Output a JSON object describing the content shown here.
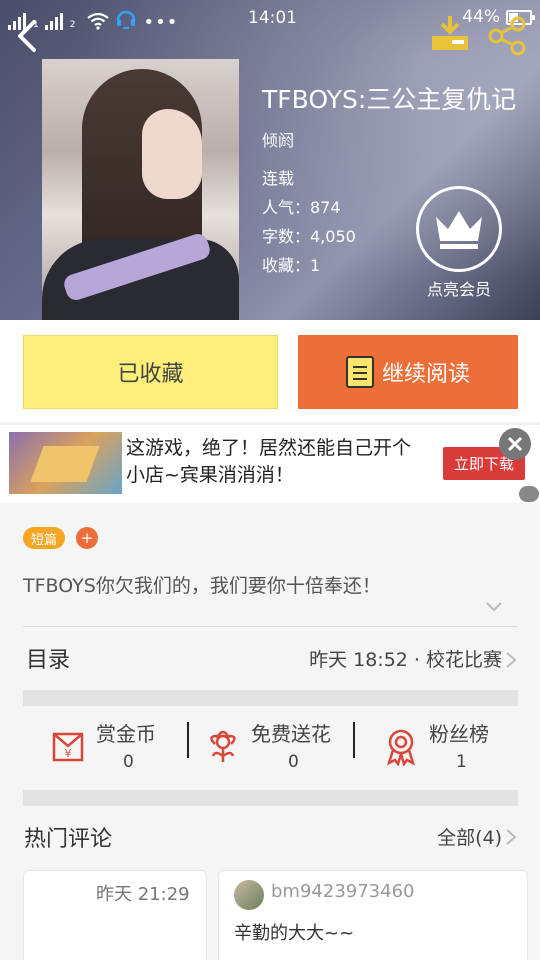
{
  "status_bar": {
    "sim1": "1",
    "sim2": "2",
    "time": "14:01",
    "battery_percent": "44%",
    "battery_level": 0.44
  },
  "book": {
    "title": "TFBOYS:三公主复仇记",
    "author": "倾阏",
    "status": "连载",
    "popularity": "人气：874",
    "word_count": "字数：4,050",
    "favorites": "收藏：1",
    "vip_label": "点亮会员"
  },
  "actions": {
    "collected_label": "已收藏",
    "continue_label": "继续阅读"
  },
  "ad": {
    "text": "这游戏，绝了！居然还能自己开个小店~宾果消消消！",
    "cta": "立即下载"
  },
  "tags": {
    "short_label": "短篇",
    "add_label": "+"
  },
  "summary": "TFBOYS你欠我们的，我们要你十倍奉还！",
  "toc": {
    "title": "目录",
    "latest": "昨天 18:52 · 校花比赛"
  },
  "stats": [
    {
      "label": "赏金币",
      "value": "0",
      "icon": "red-envelope-icon"
    },
    {
      "label": "免费送花",
      "value": "0",
      "icon": "flower-icon"
    },
    {
      "label": "粉丝榜",
      "value": "1",
      "icon": "medal-icon"
    }
  ],
  "comments": {
    "title": "热门评论",
    "all_label": "全部(4)",
    "items": [
      {
        "time": "昨天 21:29",
        "user": "",
        "text": ""
      },
      {
        "time": "",
        "user": "bm9423973460",
        "text": "辛勤的大大~~"
      }
    ]
  },
  "colors": {
    "accent_orange": "#ee6e3a",
    "collect_yellow": "#fdf07a",
    "tag_orange": "#f5a623",
    "ad_red": "#d93a3a",
    "icon_red": "#d9473a"
  }
}
